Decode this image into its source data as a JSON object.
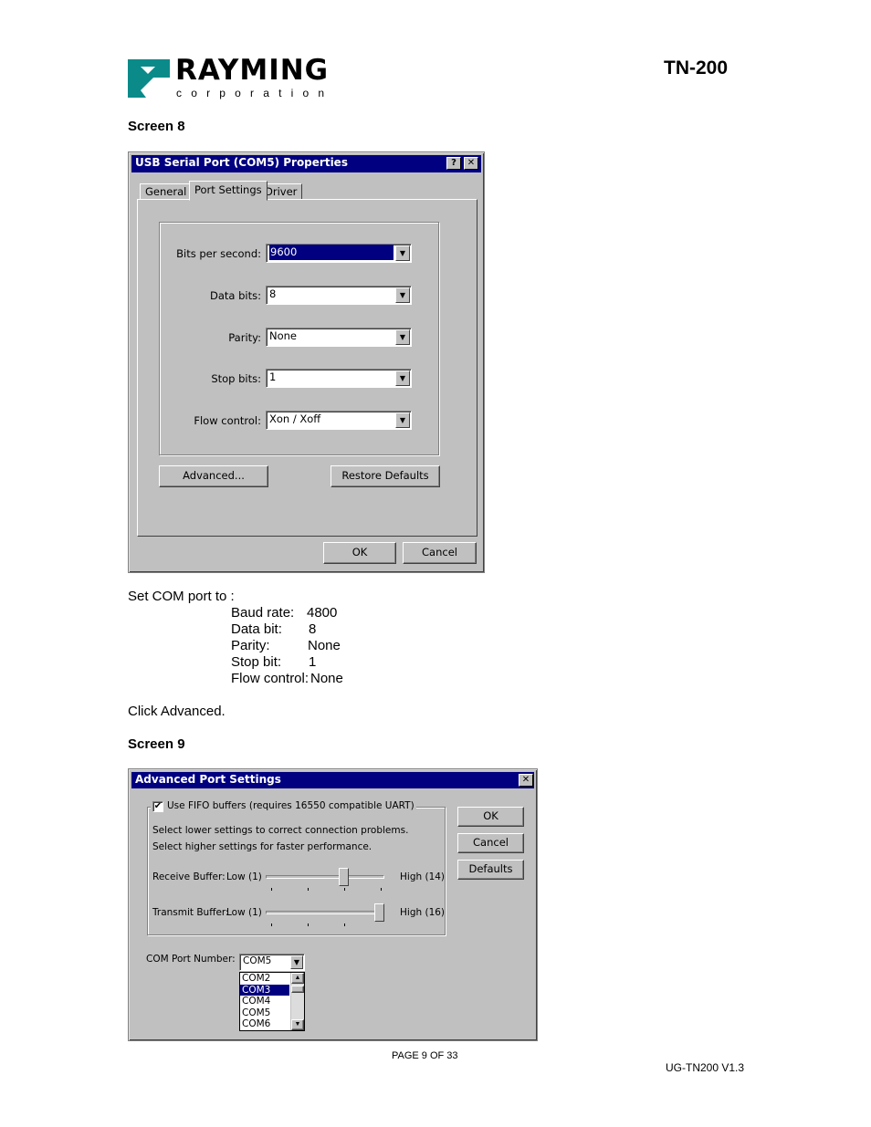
{
  "header": {
    "brand": "RAYMING",
    "brand_sub": "corporation",
    "doc_title": "TN-200"
  },
  "screen8": {
    "heading": "Screen 8",
    "window_title": "USB Serial Port (COM5) Properties",
    "title_buttons": [
      "?",
      "✕"
    ],
    "tabs": [
      "General",
      "Port Settings",
      "Driver"
    ],
    "fields": [
      {
        "label": "Bits per second:",
        "value": "9600"
      },
      {
        "label": "Data bits:",
        "value": "8"
      },
      {
        "label": "Parity:",
        "value": "None"
      },
      {
        "label": "Stop bits:",
        "value": "1"
      },
      {
        "label": "Flow control:",
        "value": "Xon / Xoff"
      }
    ],
    "advanced_button": "Advanced...",
    "restore_button": "Restore Defaults",
    "ok_button": "OK",
    "cancel_button": "Cancel"
  },
  "instructions": {
    "intro": "Set COM port to :",
    "settings": [
      {
        "label": "Baud rate:",
        "value": "4800"
      },
      {
        "label": "Data bit:",
        "value": "8"
      },
      {
        "label": "Parity:",
        "value": "None"
      },
      {
        "label": "Stop bit:",
        "value": "1"
      },
      {
        "label": "Flow control:",
        "value": "None"
      }
    ],
    "click_advanced": "Click Advanced."
  },
  "screen9": {
    "heading": "Screen 9",
    "window_title": "Advanced Port Settings",
    "close_button": "✕",
    "fifo_checkbox_label": "Use FIFO buffers (requires 16550 compatible UART)",
    "fifo_checked": true,
    "hint_line1": "Select lower settings to correct connection problems.",
    "hint_line2": "Select higher settings for faster performance.",
    "receive": {
      "label": "Receive Buffer:",
      "low": "Low (1)",
      "high": "High (14)",
      "level": 0.67
    },
    "transmit": {
      "label": "Transmit Buffer:",
      "low": "Low (1)",
      "high": "High (16)",
      "level": 1.0
    },
    "ok_button": "OK",
    "cancel_button": "Cancel",
    "defaults_button": "Defaults",
    "com_label": "COM Port Number:",
    "com_value": "COM5",
    "com_options": [
      "COM2",
      "COM3",
      "COM4",
      "COM5",
      "COM6"
    ],
    "com_highlighted": "COM3"
  },
  "footer": {
    "page": "PAGE 9 OF 33",
    "version": "UG-TN200 V1.3"
  },
  "colors": {
    "title_bar": "#000080",
    "window_face": "#c0c0c0",
    "logo_teal": "#0b8a8a"
  }
}
